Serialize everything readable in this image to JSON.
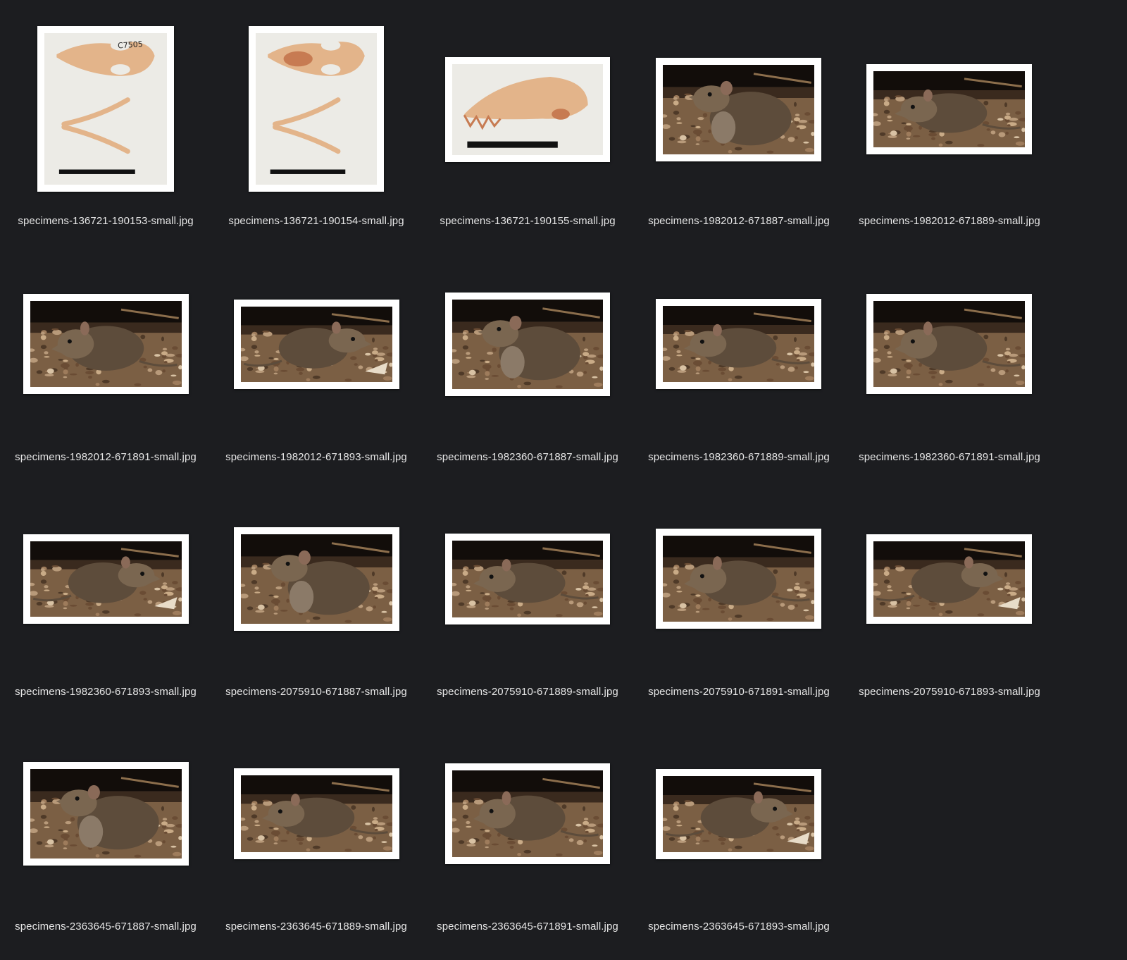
{
  "files": [
    {
      "name": "specimens-136721-190153-small.jpg",
      "kind": "skull-dorsal",
      "thumb": "skull-dorsal-icon"
    },
    {
      "name": "specimens-136721-190154-small.jpg",
      "kind": "skull-ventral",
      "thumb": "skull-ventral-icon"
    },
    {
      "name": "specimens-136721-190155-small.jpg",
      "kind": "skull-lateral",
      "thumb": "skull-lateral-icon"
    },
    {
      "name": "specimens-1982012-671887-small.jpg",
      "kind": "animal-upright",
      "thumb": "animal-photo-icon"
    },
    {
      "name": "specimens-1982012-671889-small.jpg",
      "kind": "animal-crouch-left",
      "thumb": "animal-photo-icon"
    },
    {
      "name": "specimens-1982012-671891-small.jpg",
      "kind": "animal-crouch-left",
      "thumb": "animal-photo-icon"
    },
    {
      "name": "specimens-1982012-671893-small.jpg",
      "kind": "animal-crouch-right",
      "thumb": "animal-photo-icon"
    },
    {
      "name": "specimens-1982360-671887-small.jpg",
      "kind": "animal-upright",
      "thumb": "animal-photo-icon"
    },
    {
      "name": "specimens-1982360-671889-small.jpg",
      "kind": "animal-crouch-left",
      "thumb": "animal-photo-icon"
    },
    {
      "name": "specimens-1982360-671891-small.jpg",
      "kind": "animal-crouch-left",
      "thumb": "animal-photo-icon"
    },
    {
      "name": "specimens-1982360-671893-small.jpg",
      "kind": "animal-crouch-right",
      "thumb": "animal-photo-icon"
    },
    {
      "name": "specimens-2075910-671887-small.jpg",
      "kind": "animal-upright",
      "thumb": "animal-photo-icon"
    },
    {
      "name": "specimens-2075910-671889-small.jpg",
      "kind": "animal-crouch-left",
      "thumb": "animal-photo-icon"
    },
    {
      "name": "specimens-2075910-671891-small.jpg",
      "kind": "animal-crouch-left",
      "thumb": "animal-photo-icon"
    },
    {
      "name": "specimens-2075910-671893-small.jpg",
      "kind": "animal-crouch-right",
      "thumb": "animal-photo-icon"
    },
    {
      "name": "specimens-2363645-671887-small.jpg",
      "kind": "animal-upright",
      "thumb": "animal-photo-icon"
    },
    {
      "name": "specimens-2363645-671889-small.jpg",
      "kind": "animal-crouch-left",
      "thumb": "animal-photo-icon"
    },
    {
      "name": "specimens-2363645-671891-small.jpg",
      "kind": "animal-crouch-left",
      "thumb": "animal-photo-icon"
    },
    {
      "name": "specimens-2363645-671893-small.jpg",
      "kind": "animal-crouch-right",
      "thumb": "animal-photo-icon"
    }
  ],
  "skull_tag": "C7505",
  "colors": {
    "background": "#1c1d20",
    "label": "#e6e6e6",
    "frame": "#ffffff",
    "ground": "#8a6a4a",
    "fur": "#5a4a3a"
  }
}
